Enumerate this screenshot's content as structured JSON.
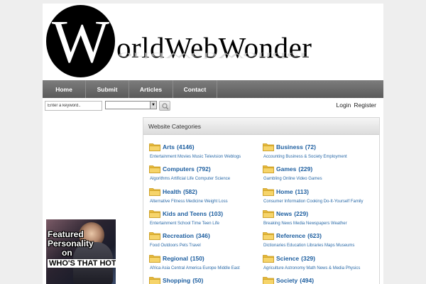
{
  "logo": {
    "initial": "W",
    "rest": "orldWebWonder"
  },
  "nav": [
    "Home",
    "Submit",
    "Articles",
    "Contact"
  ],
  "search": {
    "keyword_value": "Enter a keyword..",
    "category_selected": ""
  },
  "auth": {
    "login": "Login",
    "register": "Register"
  },
  "banner": {
    "line1": "Featured",
    "line2": "Personality",
    "line3": "on",
    "line4": "WHO'S THAT HOTTIE"
  },
  "panel": {
    "title": "Website Categories"
  },
  "colors": {
    "link": "#1e5fa0",
    "nav": "#6b6b6b",
    "folder": "#f2c94c"
  },
  "categories": [
    {
      "name": "Arts",
      "count": "(4146)",
      "subs": "Entertainment Movies Music Television Weblogs"
    },
    {
      "name": "Business",
      "count": "(72)",
      "subs": "Accounting Business & Society Employment"
    },
    {
      "name": "Computers",
      "count": "(792)",
      "subs": "Algorithms Artificial Life Computer Science"
    },
    {
      "name": "Games",
      "count": "(229)",
      "subs": "Gambling Online Video Games"
    },
    {
      "name": "Health",
      "count": "(582)",
      "subs": "Alternative Fitness Medicine Weight Loss"
    },
    {
      "name": "Home",
      "count": "(113)",
      "subs": "Consumer Information Cooking Do-It-Yourself Family"
    },
    {
      "name": "Kids and Teens",
      "count": "(103)",
      "subs": "Entertainment School Time Teen Life"
    },
    {
      "name": "News",
      "count": "(229)",
      "subs": "Breaking News Media Newspapers Weather"
    },
    {
      "name": "Recreation",
      "count": "(346)",
      "subs": "Food Outdoors Pets Travel"
    },
    {
      "name": "Reference",
      "count": "(623)",
      "subs": "Dictionaries Education Libraries Maps Museums"
    },
    {
      "name": "Regional",
      "count": "(150)",
      "subs": "Africa Asia Central America Europe Middle East"
    },
    {
      "name": "Science",
      "count": "(329)",
      "subs": "Agriculture Astronomy Math News & Media Physics"
    },
    {
      "name": "Shopping",
      "count": "(50)",
      "subs": ""
    },
    {
      "name": "Society",
      "count": "(494)",
      "subs": ""
    }
  ]
}
